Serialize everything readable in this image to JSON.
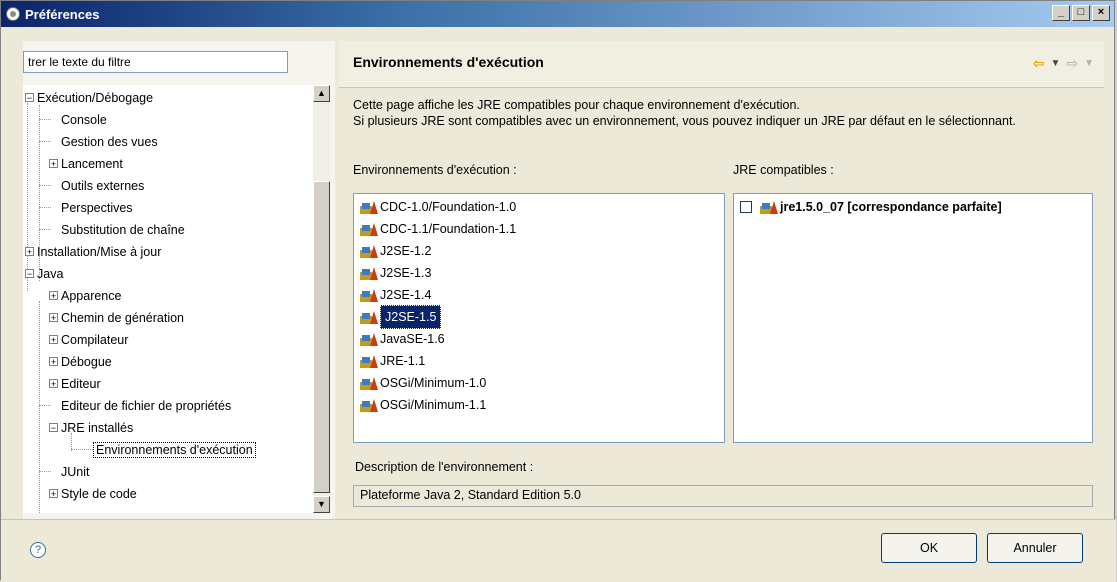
{
  "window": {
    "title": "Préférences",
    "controls": {
      "minimize": "_",
      "maximize": "□",
      "close": "×"
    }
  },
  "sidebar": {
    "filter_value": "trer le texte du filtre",
    "tree": [
      {
        "label": "Exécution/Débogage",
        "level": 0,
        "expanded": true
      },
      {
        "label": "Console",
        "level": 1
      },
      {
        "label": "Gestion des vues",
        "level": 1
      },
      {
        "label": "Lancement",
        "level": 1,
        "expandable": true
      },
      {
        "label": "Outils externes",
        "level": 1
      },
      {
        "label": "Perspectives",
        "level": 1
      },
      {
        "label": "Substitution de chaîne",
        "level": 1
      },
      {
        "label": "Installation/Mise à jour",
        "level": 0,
        "expandable": true
      },
      {
        "label": "Java",
        "level": 0,
        "expanded": true
      },
      {
        "label": "Apparence",
        "level": 1,
        "expandable": true
      },
      {
        "label": "Chemin de génération",
        "level": 1,
        "expandable": true
      },
      {
        "label": "Compilateur",
        "level": 1,
        "expandable": true
      },
      {
        "label": "Débogue",
        "level": 1,
        "expandable": true
      },
      {
        "label": "Editeur",
        "level": 1,
        "expandable": true
      },
      {
        "label": "Editeur de fichier de propriétés",
        "level": 1
      },
      {
        "label": "JRE installés",
        "level": 1,
        "expanded": true
      },
      {
        "label": "Environnements d'exécution",
        "level": 2,
        "selected": true
      },
      {
        "label": "JUnit",
        "level": 1
      },
      {
        "label": "Style de code",
        "level": 1,
        "expandable": true
      }
    ]
  },
  "main": {
    "title": "Environnements d'exécution",
    "description_line1": "Cette page affiche les JRE compatibles pour chaque environnement d'exécution.",
    "description_line2": "Si plusieurs JRE sont compatibles avec un environnement, vous pouvez indiquer un JRE par défaut en le sélectionnant.",
    "env_label": "Environnements d'exécution :",
    "jre_label": "JRE compatibles :",
    "environments": [
      "CDC-1.0/Foundation-1.0",
      "CDC-1.1/Foundation-1.1",
      "J2SE-1.2",
      "J2SE-1.3",
      "J2SE-1.4",
      "J2SE-1.5",
      "JavaSE-1.6",
      "JRE-1.1",
      "OSGi/Minimum-1.0",
      "OSGi/Minimum-1.1"
    ],
    "selected_environment": "J2SE-1.5",
    "compatible_jres": [
      "jre1.5.0_07 [correspondance parfaite]"
    ],
    "env_description_label": "Description de l'environnement :",
    "env_description_value": "Plateforme Java 2, Standard Edition 5.0"
  },
  "footer": {
    "help": "?",
    "ok": "OK",
    "cancel": "Annuler"
  },
  "colors": {
    "title_bar": "#0a246a",
    "selection": "#0a246a",
    "nav_back": "#e8a000"
  }
}
